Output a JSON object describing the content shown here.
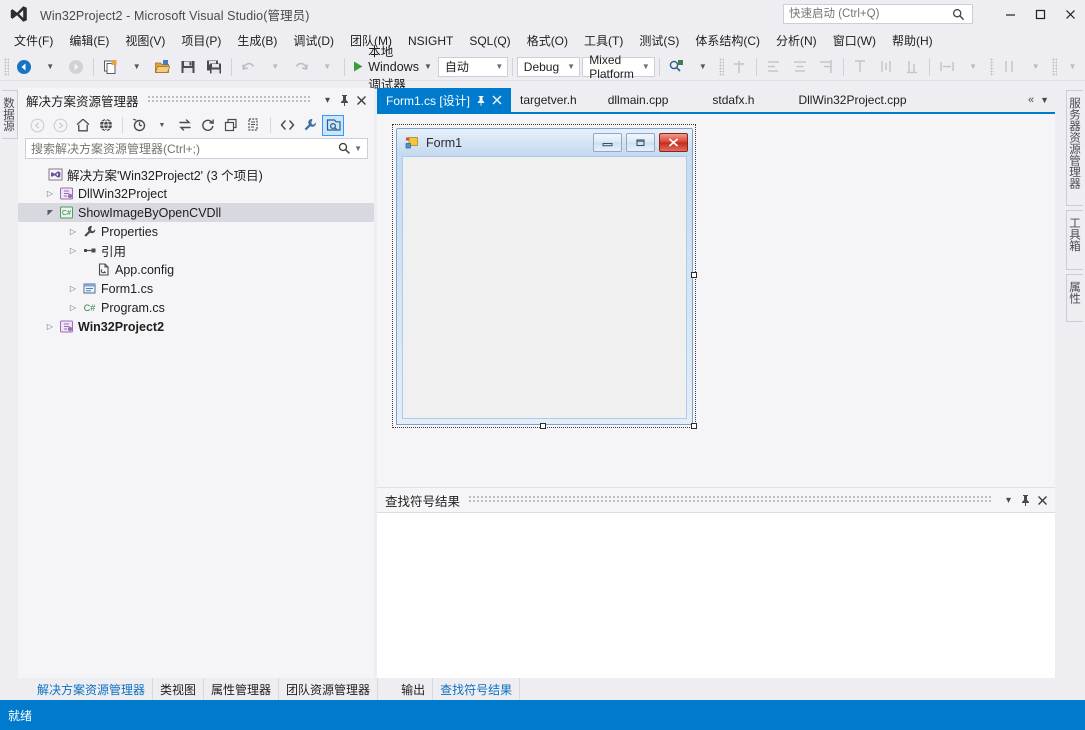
{
  "window": {
    "title": "Win32Project2 - Microsoft Visual Studio(管理员)",
    "logo_icon": "visual-studio-logo",
    "minimize_label": "−",
    "maximize_label": "▢",
    "close_label": "✕"
  },
  "quick_launch": {
    "placeholder": "快速启动 (Ctrl+Q)",
    "value": "",
    "icon": "search-icon"
  },
  "menu": {
    "items": [
      {
        "label": "文件(F)",
        "key": "F"
      },
      {
        "label": "编辑(E)",
        "key": "E"
      },
      {
        "label": "视图(V)",
        "key": "V"
      },
      {
        "label": "项目(P)",
        "key": "P"
      },
      {
        "label": "生成(B)",
        "key": "B"
      },
      {
        "label": "调试(D)",
        "key": "D"
      },
      {
        "label": "团队(M)",
        "key": "M"
      },
      {
        "label": "NSIGHT",
        "key": "N"
      },
      {
        "label": "SQL(Q)",
        "key": "Q"
      },
      {
        "label": "格式(O)",
        "key": "O"
      },
      {
        "label": "工具(T)",
        "key": "T"
      },
      {
        "label": "测试(S)",
        "key": "S"
      },
      {
        "label": "体系结构(C)",
        "key": "C"
      },
      {
        "label": "分析(N)",
        "key": "N"
      },
      {
        "label": "窗口(W)",
        "key": "W"
      },
      {
        "label": "帮助(H)",
        "key": "H"
      }
    ]
  },
  "toolbar": {
    "run_label": "本地 Windows 调试器",
    "run_icon": "play-icon",
    "config_value": "自动",
    "debug_value": "Debug",
    "platform_value": "Mixed Platform",
    "icons": [
      "navigate-back-icon",
      "navigate-forward-icon",
      "new-project-icon",
      "open-file-icon",
      "save-icon",
      "save-all-icon",
      "undo-icon",
      "redo-icon",
      "find-in-files-icon",
      "attach-icon",
      "align-lefts-icon",
      "align-centers-icon",
      "align-rights-icon",
      "align-tops-icon",
      "align-middles-icon",
      "align-bottoms-icon",
      "make-same-width-icon",
      "horizontal-spacing-icon",
      "vertical-spacing-icon"
    ]
  },
  "left_strip": {
    "tabs": [
      {
        "label": "数据源",
        "name": "data-sources"
      }
    ]
  },
  "solution_explorer": {
    "title": "解决方案资源管理器",
    "header_buttons": [
      {
        "icon": "chevron-down-icon",
        "glyph": "▾",
        "name": "window-dropdown-button"
      },
      {
        "icon": "pin-icon",
        "glyph": "⚲",
        "name": "auto-hide-button"
      },
      {
        "icon": "close-icon",
        "glyph": "✕",
        "name": "close-panel-button"
      }
    ],
    "toolbar_icons": [
      {
        "name": "back-icon",
        "glyph": "◀",
        "disabled": true
      },
      {
        "name": "forward-icon",
        "glyph": "▶",
        "disabled": true
      },
      {
        "name": "home-icon",
        "glyph": "⌂",
        "disabled": false
      },
      {
        "name": "globe-icon",
        "glyph": "◉",
        "disabled": false
      },
      {
        "name": "pending-changes-icon",
        "glyph": "◔",
        "disabled": false
      },
      {
        "name": "sync-icon",
        "glyph": "⇄",
        "disabled": false
      },
      {
        "name": "refresh-icon",
        "glyph": "↻",
        "disabled": false
      },
      {
        "name": "collapse-all-icon",
        "glyph": "▣",
        "disabled": false
      },
      {
        "name": "show-all-files-icon",
        "glyph": "▤",
        "disabled": false
      },
      {
        "name": "view-code-icon",
        "glyph": "<>",
        "disabled": false
      },
      {
        "name": "properties-wrench-icon",
        "glyph": "🔧",
        "disabled": false
      },
      {
        "name": "preview-selected-items-icon",
        "glyph": "▣",
        "disabled": false,
        "active": true
      }
    ],
    "search": {
      "placeholder": "搜索解决方案资源管理器(Ctrl+;)",
      "value": "",
      "icon": "search-icon",
      "dropdown_icon": "chevron-down-icon"
    },
    "tree": [
      {
        "label": "解决方案'Win32Project2' (3 个项目)",
        "indent": 0,
        "expander": "",
        "icon": "solution-icon",
        "selected": false,
        "bold": false
      },
      {
        "label": "DllWin32Project",
        "indent": 1,
        "expander": "▷",
        "icon": "cpp-project-icon",
        "selected": false,
        "bold": false
      },
      {
        "label": "ShowImageByOpenCVDll",
        "indent": 1,
        "expander": "◢",
        "icon": "csharp-project-icon",
        "selected": true,
        "bold": false
      },
      {
        "label": "Properties",
        "indent": 2,
        "expander": "▷",
        "icon": "wrench-icon",
        "selected": false,
        "bold": false
      },
      {
        "label": "引用",
        "indent": 2,
        "expander": "▷",
        "icon": "references-icon",
        "selected": false,
        "bold": false
      },
      {
        "label": "App.config",
        "indent": 3,
        "expander": "",
        "icon": "config-file-icon",
        "selected": false,
        "bold": false
      },
      {
        "label": "Form1.cs",
        "indent": 2,
        "expander": "▷",
        "icon": "form-file-icon",
        "selected": false,
        "bold": false
      },
      {
        "label": "Program.cs",
        "indent": 2,
        "expander": "▷",
        "icon": "csharp-file-icon",
        "selected": false,
        "bold": false
      },
      {
        "label": "Win32Project2",
        "indent": 1,
        "expander": "▷",
        "icon": "cpp-project-icon",
        "selected": false,
        "bold": true
      }
    ]
  },
  "editor": {
    "tabs": [
      {
        "label": "Form1.cs [设计]",
        "active": true,
        "pin_icon": "pin-icon",
        "close_icon": "close-icon"
      },
      {
        "label": "targetver.h",
        "active": false
      },
      {
        "label": "dllmain.cpp",
        "active": false
      },
      {
        "label": "stdafx.h",
        "active": false
      },
      {
        "label": "DllWin32Project.cpp",
        "active": false
      }
    ],
    "overflow": {
      "scroll_icon": "chevron-double-left-icon",
      "scroll_glyph": "«",
      "list_icon": "chevron-down-icon",
      "list_glyph": "▼"
    }
  },
  "designer": {
    "form_title": "Form1",
    "form_icon": "winform-icon",
    "minimize_label": "—",
    "maximize_label": "▫",
    "close_label": "✕",
    "handles": [
      "middle-right",
      "bottom-center",
      "bottom-right"
    ]
  },
  "find_results": {
    "title": "查找符号结果",
    "header_buttons": [
      {
        "icon": "chevron-down-icon",
        "glyph": "▾",
        "name": "window-dropdown-button"
      },
      {
        "icon": "pin-icon",
        "glyph": "⚲",
        "name": "auto-hide-button"
      },
      {
        "icon": "close-icon",
        "glyph": "✕",
        "name": "close-panel-button"
      }
    ],
    "content": ""
  },
  "right_strip": {
    "tabs": [
      {
        "label": "服务器资源管理器",
        "name": "server-explorer"
      },
      {
        "label": "工具箱",
        "name": "toolbox"
      },
      {
        "label": "属性",
        "name": "properties"
      }
    ],
    "overflow_icon": "chevron-down-icon",
    "overflow_glyph": "▼"
  },
  "bottom_tabs": {
    "left_group": [
      {
        "label": "解决方案资源管理器",
        "active": true
      },
      {
        "label": "类视图",
        "active": false
      },
      {
        "label": "属性管理器",
        "active": false
      },
      {
        "label": "团队资源管理器",
        "active": false
      }
    ],
    "right_group": [
      {
        "label": "输出",
        "active": false
      },
      {
        "label": "查找符号结果",
        "active": true
      }
    ]
  },
  "status_bar": {
    "text": "就绪"
  },
  "colors": {
    "accent": "#007acc",
    "chrome": "#eeeef2",
    "panel": "#f5f5f7",
    "selection": "#d8d8e0",
    "link": "#0e70c0",
    "close_red": "#c62b1c",
    "play_green": "#3a9c3a"
  }
}
